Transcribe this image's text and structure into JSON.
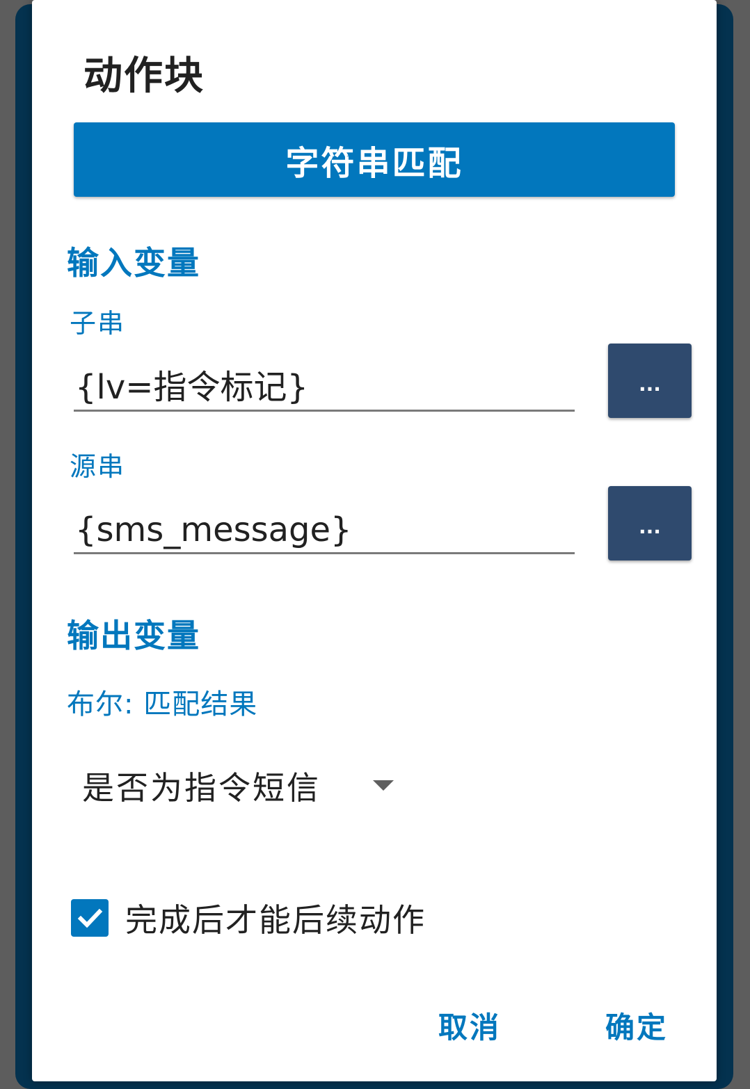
{
  "dialog": {
    "title": "动作块",
    "action_type_label": "字符串匹配"
  },
  "input_section": {
    "header": "输入变量",
    "fields": [
      {
        "label": "子串",
        "value": "{lv=指令标记}",
        "more_label": "..."
      },
      {
        "label": "源串",
        "value": "{sms_message}",
        "more_label": "..."
      }
    ]
  },
  "output_section": {
    "header": "输出变量",
    "variable_label": "布尔: 匹配结果",
    "selected_variable": "是否为指令短信"
  },
  "wait_option": {
    "label": "完成后才能后续动作",
    "checked": true
  },
  "buttons": {
    "cancel": "取消",
    "ok": "确定"
  },
  "colors": {
    "accent": "#0277bd",
    "more_button": "#2f4a6e",
    "backdrop": "#04324f"
  }
}
